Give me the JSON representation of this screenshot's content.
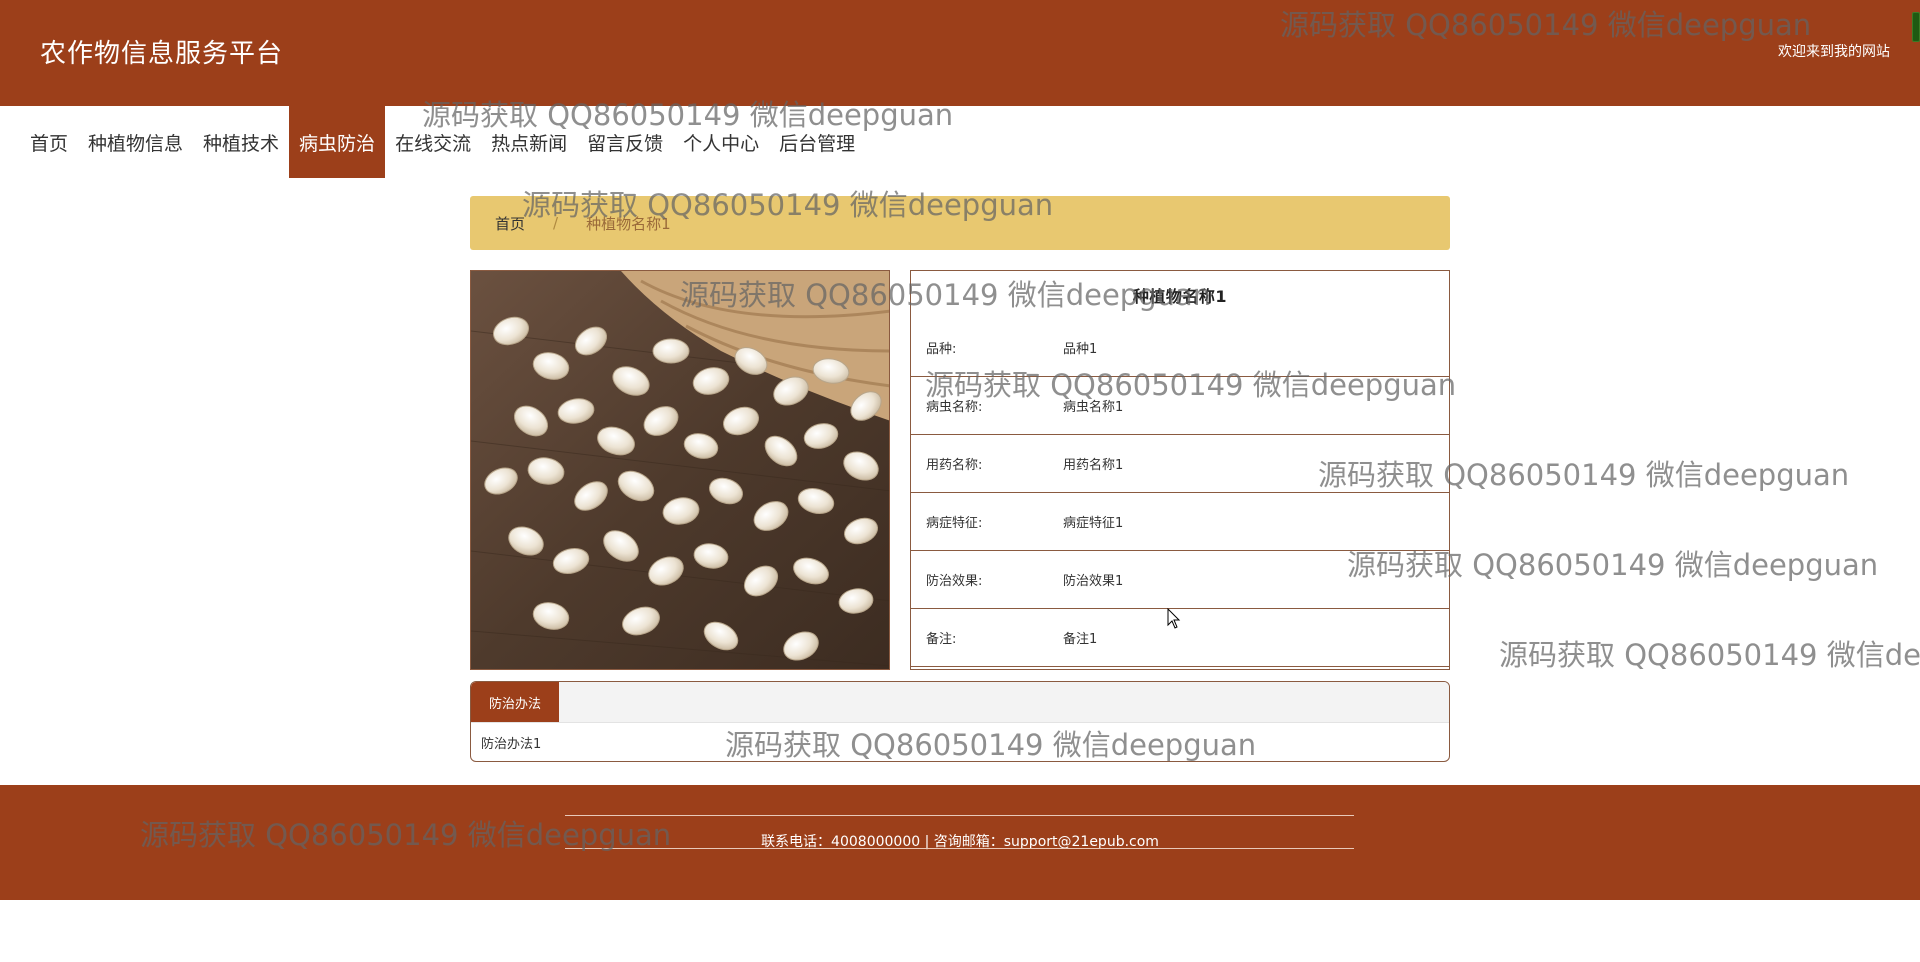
{
  "header": {
    "site_title": "农作物信息服务平台",
    "welcome": "欢迎来到我的网站"
  },
  "nav": {
    "items": [
      "首页",
      "种植物信息",
      "种植技术",
      "病虫防治",
      "在线交流",
      "热点新闻",
      "留言反馈",
      "个人中心",
      "后台管理"
    ],
    "active": "病虫防治"
  },
  "breadcrumb": {
    "home": "首页",
    "separator": "/",
    "current": "种植物名称1"
  },
  "photo": {
    "subject": "white ginkgo nuts spilling from a woven basket on dark wood"
  },
  "details": {
    "title": "种植物名称1",
    "rows": [
      {
        "label": "品种:",
        "value": "品种1"
      },
      {
        "label": "病虫名称:",
        "value": "病虫名称1"
      },
      {
        "label": "用药名称:",
        "value": "用药名称1"
      },
      {
        "label": "病症特征:",
        "value": "病症特征1"
      },
      {
        "label": "防治效果:",
        "value": "防治效果1"
      },
      {
        "label": "备注:",
        "value": "备注1"
      }
    ]
  },
  "tabs": {
    "active_tab": "防治办法",
    "content": "防治办法1"
  },
  "footer": {
    "contact": "联系电话：4008000000 | 咨询邮箱：support@21epub.com"
  },
  "watermark_text": "源码获取 QQ86050149 微信deepguan",
  "colors": {
    "primary": "#9c3f1a",
    "breadcrumb_bg": "#e8c870",
    "border": "#8a5a40"
  }
}
